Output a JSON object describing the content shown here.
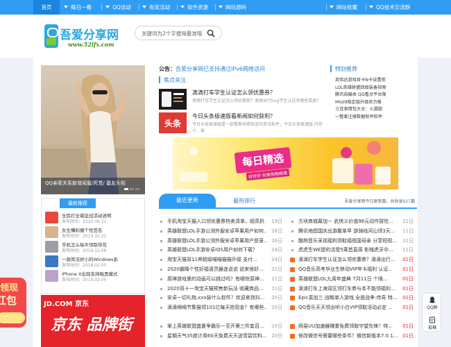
{
  "nav": {
    "items": [
      {
        "label": "首页",
        "dropdown": false
      },
      {
        "label": "每日一看",
        "dropdown": true
      },
      {
        "label": "QQ活动",
        "dropdown": true
      },
      {
        "label": "有奖活动",
        "dropdown": true
      },
      {
        "label": "软件资源",
        "dropdown": true
      },
      {
        "label": "网站源码",
        "dropdown": true
      }
    ],
    "right_items": [
      {
        "label": "网站收藏",
        "dropdown": true
      },
      {
        "label": "QQ技术交流群",
        "dropdown": true
      }
    ]
  },
  "header": {
    "logo_text": "吾爱分享网",
    "logo_url": "www.52lfx.com",
    "search_placeholder": "关键词为2个字搜得最准哦"
  },
  "slider": {
    "caption": "QQ亲密关系新增闺蜜/死党/ 基友头衔",
    "watermark": "52lfx.com"
  },
  "recent": {
    "tab_label": "最新推荐",
    "date_prefix": "发布时间：",
    "items": [
      {
        "title": "全民打全城征战活动说明",
        "date": "2020.06.21",
        "color": "#e8473b"
      },
      {
        "title": "女生購彩圈个性签名",
        "date": "2019.10.22",
        "color": "#d8b48c"
      },
      {
        "title": "手机怎么每天领取带花",
        "date": "2019.12.08",
        "color": "#9b9ea4"
      },
      {
        "title": "一款简洁好小的Windows系",
        "date": "2018.02.05",
        "color": "#3b78c9"
      },
      {
        "title": "iPhone X出现支持暗黑模式",
        "date": "2019.02.05",
        "color": "#b9a4c8"
      }
    ]
  },
  "jd_ad": {
    "logo": "JD.COM 京东",
    "big_text": "京东 品牌街"
  },
  "envelope": {
    "top": "领现",
    "bottom": "红包"
  },
  "announce": {
    "label": "公告：",
    "text": "吾爱分享网已支持通过IPv6网络访问"
  },
  "focus": {
    "title": "焦点关注",
    "items": [
      {
        "title": "滴滴打车学生认证怎么领优惠券？",
        "desc": "滴滴打车学生认证怎么领优惠券？滴滴出行bug学生认证有哪些奖励？"
      },
      {
        "title": "今日头条极速版看新闻如何获利？",
        "desc": "今日头条极速版是一款看新闻得现金的资讯软件，今日头条极速版 内存小、省"
      }
    ]
  },
  "recommend": {
    "title": "特别推荐",
    "items": [
      "英伟达游戏官卡N卡设置视",
      "LOL英雄联盟回级装备视频",
      "腾讯自媒体 QQ看点平台限",
      "MIUI9稳定版升级官方推",
      "三连表情包大全：火漏胆",
      "一整套注册数据软件软件"
    ]
  },
  "banner": {
    "title": "每日精选",
    "subtitle": "好好好 你爱购物商城"
  },
  "tabs": {
    "active": "最近更新",
    "inactive": "最热排行",
    "stats_prefix": "吾爱分享网今日更新",
    "today": "",
    "total_prefix": "篇，共收录",
    "total": "927",
    "suffix": "篇"
  },
  "articles_left": [
    {
      "title": "手机淘宝天猫入口领优惠券热卖清单，超高折...",
      "date": "19日",
      "new": false
    },
    {
      "title": "英雄联盟LOL手游公测外服安卓苹果用户如何...",
      "date": "26日",
      "new": false
    },
    {
      "title": "英雄联盟LOL手游公测外服安卓苹果用户登录...",
      "date": "26日",
      "new": false
    },
    {
      "title": "英雄联盟LOL手游安卓iOS用户如何下载？",
      "date": "24日",
      "new": false
    },
    {
      "title": "淘宝天猫双11养超级喵喵猫猫升级 支付...",
      "date": "24日",
      "new": false
    },
    {
      "title": "2020霸降个性好福语灵器连说说 说来很好...",
      "date": "22日",
      "new": false
    },
    {
      "title": "原神游戏里的动画可以跳过吗？有哪些原神...",
      "date": "21日",
      "new": false
    },
    {
      "title": "2020双十一淘宝天猫预售新玩法 收藏商品...",
      "date": "21日",
      "new": false
    },
    {
      "title": "安卓一切礼物,xxx装什么软件？欢迎来到抖...",
      "date": "20日",
      "new": false
    },
    {
      "title": "滴滴嘀嘀节集猫领101亿每天抢现金？有哪些...",
      "date": "20日",
      "new": false
    },
    {
      "title": "掌上英雄联盟盛夏争霸乐一至开第三件套百...",
      "date": "20日",
      "new": false
    },
    {
      "title": "星期天气35度计用60天免费天天送雪碧饮料...",
      "date": "20日",
      "new": false
    }
  ],
  "articles_right": [
    {
      "title": "方块商城幕加一 武侠义价值98元动作冒险...",
      "date": "11日",
      "new": false
    },
    {
      "title": "腾讯地图国庆出游赢单早 游骑线河山领3天...",
      "date": "11日",
      "new": false
    },
    {
      "title": "酷狗音乐采视福利领取福祖国母亲 分享短视...",
      "date": "11日",
      "new": false
    },
    {
      "title": "虎虎生WE提的活受5乘首直周 影械虎牙中...",
      "date": "11日",
      "new": false
    },
    {
      "title": "滴滴打车学生认证怎么领优惠券？滴滴出行...",
      "date": "01日",
      "new": true
    },
    {
      "title": "QQ音乐高考毕业生移动VIP年卡福利 认证...",
      "date": "01日",
      "new": true
    },
    {
      "title": "英雄联盟LOL九周年盛典 7月11日 个限...",
      "date": "01日",
      "new": true
    },
    {
      "title": "滴滴打车上海双区领打车券与本不能领福利...",
      "date": "01日",
      "new": true
    },
    {
      "title": "Epic喜加三 战略单人游戏 全面战争:传奇 特...",
      "date": "01日",
      "new": true
    },
    {
      "title": "QQ音乐天天领出听小白VIP领取活动必定 ...",
      "date": "01日",
      "new": true
    },
    {
      "title": "网易UU加速器赚重免费领取守望先锋？特...",
      "date": "01日",
      "new": true
    },
    {
      "title": "修改微信号需要哪些条件？微信新版本7.0.1...",
      "date": "01日",
      "new": true
    }
  ],
  "float": {
    "qq_group": "QQ群",
    "submit": "投稿"
  },
  "colors": {
    "accent": "#2f9df4",
    "link": "#2f7fd6",
    "new_date": "#e22222"
  }
}
